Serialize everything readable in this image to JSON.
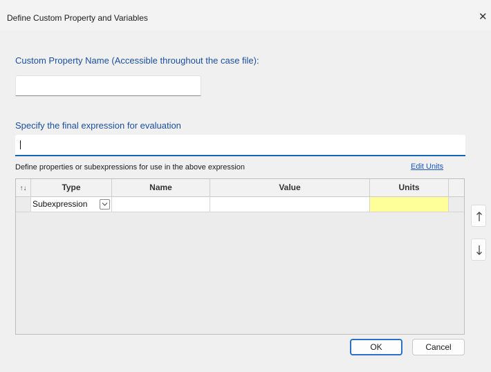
{
  "window": {
    "title": "Define Custom Property and Variables",
    "close_glyph": "✕"
  },
  "custom_property": {
    "label": "Custom Property Name (Accessible throughout the case file):",
    "value": ""
  },
  "expression": {
    "label": "Specify the final expression for evaluation",
    "value": ""
  },
  "definitions": {
    "label": "Define properties or subexpressions for use in the above expression",
    "edit_units_link": "Edit Units"
  },
  "grid": {
    "sort_glyph": "↑↓",
    "columns": [
      "Type",
      "Name",
      "Value",
      "Units"
    ],
    "rows": [
      {
        "type": "Subexpression",
        "name": "",
        "value": "",
        "units": ""
      }
    ]
  },
  "side_buttons": {
    "move_up_icon": "arrow-up-icon",
    "move_down_icon": "arrow-down-icon"
  },
  "buttons": {
    "ok": "OK",
    "cancel": "Cancel"
  },
  "colors": {
    "label_blue": "#1a4fa0",
    "link_blue": "#1a55c0",
    "focus_underline": "#1266b8",
    "units_highlight": "#ffff99"
  }
}
